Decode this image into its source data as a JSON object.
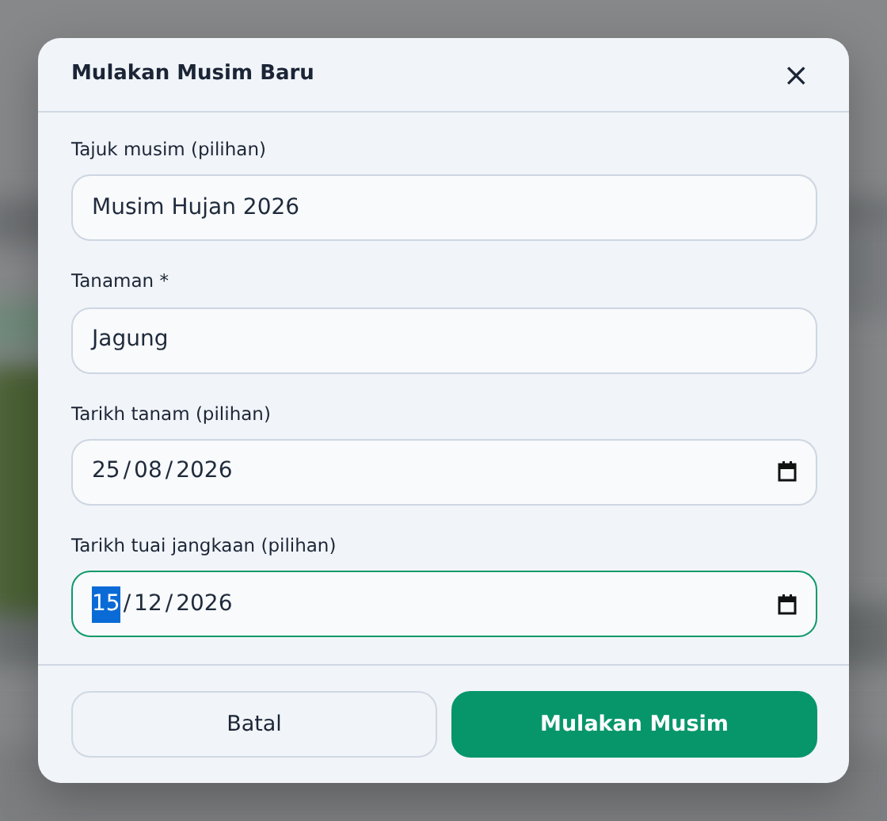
{
  "dialog": {
    "title": "Mulakan Musim Baru",
    "close": "×"
  },
  "fields": [
    {
      "kind": "text",
      "label": "Tajuk musim (pilihan)",
      "value": "Musim Hujan 2026",
      "focused": false
    },
    {
      "kind": "text",
      "label": "Tanaman *",
      "value": "Jagung",
      "focused": false
    },
    {
      "kind": "date",
      "label": "Tarikh tanam (pilihan)",
      "separator": "/",
      "parts": [
        {
          "text": "25",
          "selected": false
        },
        {
          "text": "08",
          "selected": false
        },
        {
          "text": "2026",
          "selected": false
        }
      ],
      "focused": false
    },
    {
      "kind": "date",
      "label": "Tarikh tuai jangkaan (pilihan)",
      "separator": "/",
      "parts": [
        {
          "text": "15",
          "selected": true
        },
        {
          "text": "12",
          "selected": false
        },
        {
          "text": "2026",
          "selected": false
        }
      ],
      "focused": true
    }
  ],
  "buttons": [
    {
      "label": "Batal",
      "kind": "secondary"
    },
    {
      "label": "Mulakan Musim",
      "kind": "primary"
    }
  ]
}
